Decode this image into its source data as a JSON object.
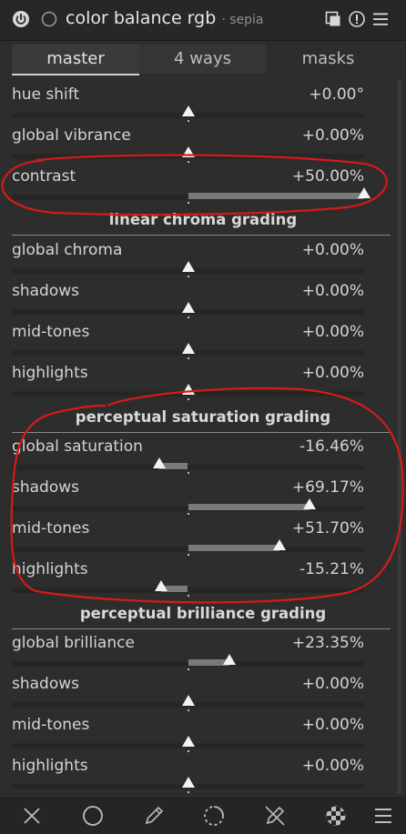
{
  "header": {
    "title": "color balance rgb",
    "subtitle": "· sepia",
    "icons": [
      "power-icon",
      "circle-icon",
      "presets-icon",
      "reset-icon",
      "menu-icon"
    ]
  },
  "tabs": [
    {
      "label": "master",
      "active": true
    },
    {
      "label": "4 ways",
      "active": false
    },
    {
      "label": "masks",
      "active": false
    }
  ],
  "master": {
    "hue_shift": {
      "label": "hue shift",
      "value": "+0.00°",
      "num": 0
    },
    "global_vibrance": {
      "label": "global vibrance",
      "value": "+0.00%",
      "num": 0
    },
    "contrast": {
      "label": "contrast",
      "value": "+50.00%",
      "num": 50
    }
  },
  "linear_chroma": {
    "title": "linear chroma grading",
    "global": {
      "label": "global chroma",
      "value": "+0.00%",
      "num": 0
    },
    "shadows": {
      "label": "shadows",
      "value": "+0.00%",
      "num": 0
    },
    "midtones": {
      "label": "mid-tones",
      "value": "+0.00%",
      "num": 0
    },
    "highlights": {
      "label": "highlights",
      "value": "+0.00%",
      "num": 0
    }
  },
  "perceptual_saturation": {
    "title": "perceptual saturation grading",
    "global": {
      "label": "global saturation",
      "value": "-16.46%",
      "num": -16.46
    },
    "shadows": {
      "label": "shadows",
      "value": "+69.17%",
      "num": 69.17
    },
    "midtones": {
      "label": "mid-tones",
      "value": "+51.70%",
      "num": 51.7
    },
    "highlights": {
      "label": "highlights",
      "value": "-15.21%",
      "num": -15.21
    }
  },
  "perceptual_brilliance": {
    "title": "perceptual brilliance grading",
    "global": {
      "label": "global brilliance",
      "value": "+23.35%",
      "num": 23.35
    },
    "shadows": {
      "label": "shadows",
      "value": "+0.00%",
      "num": 0
    },
    "midtones": {
      "label": "mid-tones",
      "value": "+0.00%",
      "num": 0
    },
    "highlights": {
      "label": "highlights",
      "value": "+0.00%",
      "num": 0
    }
  },
  "bottom_bar": {
    "icons": [
      "close-icon",
      "circle-icon",
      "pencil-icon",
      "dashed-circle-icon",
      "pencil-slash-icon",
      "checkerboard-icon",
      "menu-icon"
    ]
  },
  "colors": {
    "background": "#2d2d2d",
    "annotation": "#d61a1a",
    "marker": "#f2f2f2",
    "fill": "#7a7a7a"
  }
}
